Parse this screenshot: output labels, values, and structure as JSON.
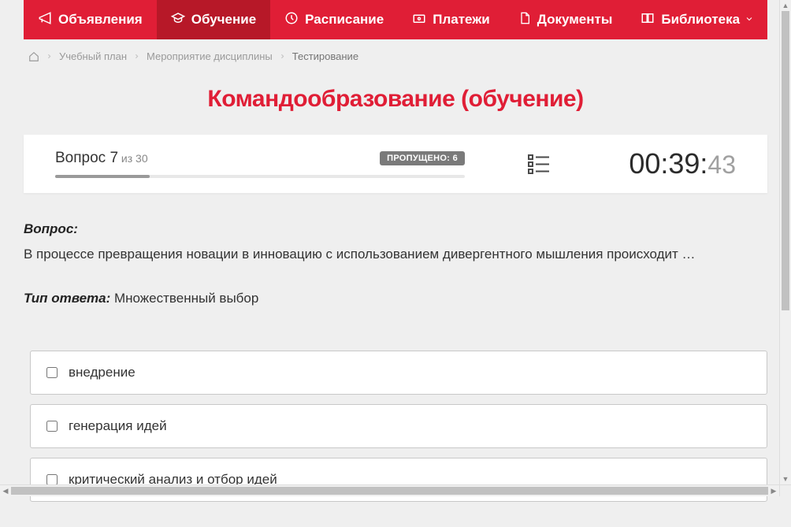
{
  "nav": {
    "items": [
      {
        "label": "Объявления",
        "icon": "megaphone-icon"
      },
      {
        "label": "Обучение",
        "icon": "cap-icon",
        "active": true
      },
      {
        "label": "Расписание",
        "icon": "clock-icon"
      },
      {
        "label": "Платежи",
        "icon": "payment-icon"
      },
      {
        "label": "Документы",
        "icon": "document-icon"
      },
      {
        "label": "Библиотека",
        "icon": "book-icon",
        "has_dropdown": true
      }
    ]
  },
  "breadcrumb": {
    "items": [
      {
        "label": "Учебный план"
      },
      {
        "label": "Мероприятие дисциплины"
      }
    ],
    "current": "Тестирование"
  },
  "page": {
    "title": "Командообразование (обучение)"
  },
  "quiz": {
    "question_label": "Вопрос 7",
    "total_suffix": " из 30",
    "skipped_badge": "ПРОПУЩЕНО: 6",
    "progress_percent": 23,
    "timer": {
      "main": "00:39:",
      "seconds": "43"
    }
  },
  "question": {
    "prefix": "Вопрос:",
    "text": "В процессе превращения новации в инновацию с использованием дивергентного мышления происходит …",
    "answer_type_label": "Тип ответа:",
    "answer_type_value": " Множественный выбор"
  },
  "options": [
    {
      "label": "внедрение"
    },
    {
      "label": "генерация идей"
    },
    {
      "label": "критический анализ и отбор идей"
    }
  ]
}
